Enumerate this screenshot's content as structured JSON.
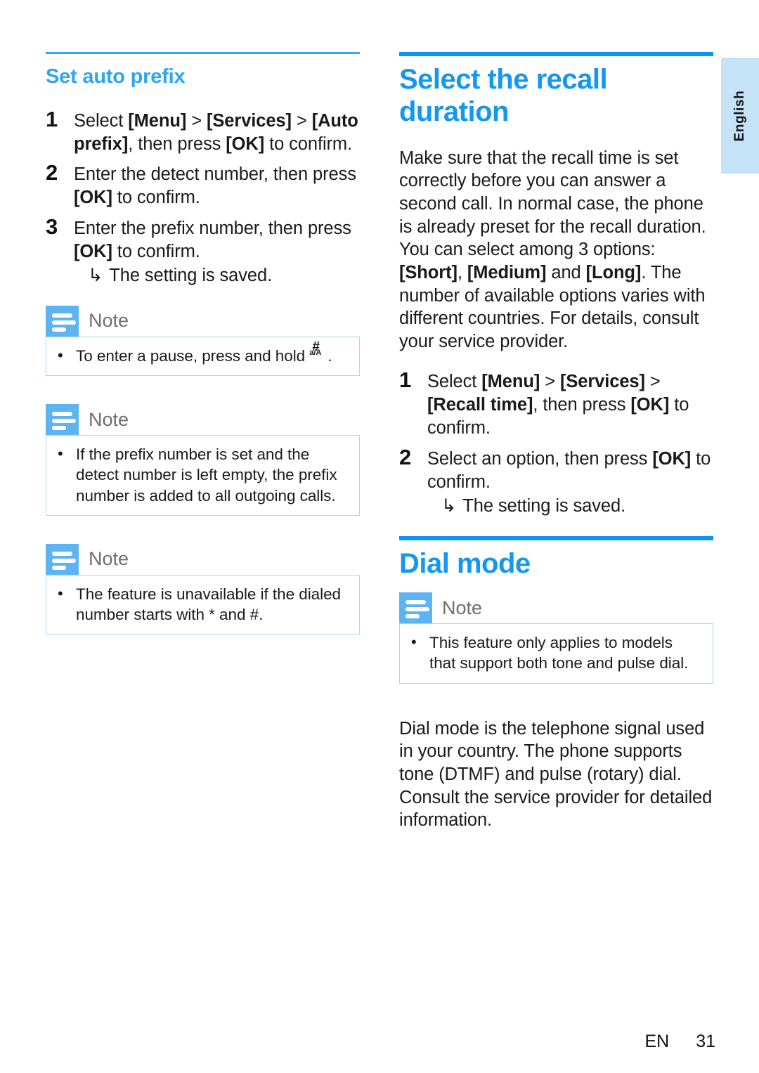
{
  "language_tab": {
    "label": "English"
  },
  "colors": {
    "heading_blue": "#1497f0",
    "subheading_blue": "#2fa5f2",
    "rule_blue": "#0d94f5",
    "note_icon_blue": "#5cb5f2",
    "note_border_blue": "#a6d7f3",
    "lang_tab_blue": "#c5e3f7"
  },
  "left_column": {
    "subheading": "Set auto prefix",
    "steps": [
      {
        "number": "1",
        "text_parts": [
          {
            "t": "Select ",
            "bold": false
          },
          {
            "t": "[Menu]",
            "bold": true
          },
          {
            "t": " > ",
            "bold": false
          },
          {
            "t": "[Services]",
            "bold": true
          },
          {
            "t": " > ",
            "bold": false
          },
          {
            "t": "[Auto prefix]",
            "bold": true
          },
          {
            "t": ", then press ",
            "bold": false
          },
          {
            "t": "[OK]",
            "bold": true
          },
          {
            "t": " to confirm.",
            "bold": false
          }
        ]
      },
      {
        "number": "2",
        "text_parts": [
          {
            "t": "Enter the detect number, then press ",
            "bold": false
          },
          {
            "t": "[OK]",
            "bold": true
          },
          {
            "t": " to confirm.",
            "bold": false
          }
        ]
      },
      {
        "number": "3",
        "text_parts": [
          {
            "t": "Enter the prefix number, then press ",
            "bold": false
          },
          {
            "t": "[OK]",
            "bold": true
          },
          {
            "t": " to confirm.",
            "bold": false
          }
        ],
        "result": "The setting is saved.",
        "result_arrow": "↳"
      }
    ],
    "notes": [
      {
        "title": "Note",
        "bullet": "•",
        "text_before": "To enter a pause, press and hold ",
        "key_glyph": {
          "main": "#",
          "sub": "a/A"
        },
        "text_after": "."
      },
      {
        "title": "Note",
        "bullet": "•",
        "text": "If the prefix number is set and the detect number is left empty, the prefix number is added to all outgoing calls."
      },
      {
        "title": "Note",
        "bullet": "•",
        "text": "The feature is unavailable if the dialed number starts with * and #."
      }
    ]
  },
  "right_column": {
    "section1": {
      "heading": "Select the recall duration",
      "paragraph_parts": [
        {
          "t": "Make sure that the recall time is set correctly before you can answer a second call. In normal case, the phone is already preset for the recall duration. You can select among 3 options: ",
          "bold": false
        },
        {
          "t": "[Short]",
          "bold": true
        },
        {
          "t": ", ",
          "bold": false
        },
        {
          "t": "[Medium]",
          "bold": true
        },
        {
          "t": " and ",
          "bold": false
        },
        {
          "t": "[Long]",
          "bold": true
        },
        {
          "t": ". The number of available options varies with different countries. For details, consult your service provider.",
          "bold": false
        }
      ],
      "steps": [
        {
          "number": "1",
          "text_parts": [
            {
              "t": "Select ",
              "bold": false
            },
            {
              "t": "[Menu]",
              "bold": true
            },
            {
              "t": " > ",
              "bold": false
            },
            {
              "t": "[Services]",
              "bold": true
            },
            {
              "t": " > ",
              "bold": false
            },
            {
              "t": "[Recall time]",
              "bold": true
            },
            {
              "t": ", then press ",
              "bold": false
            },
            {
              "t": "[OK]",
              "bold": true
            },
            {
              "t": " to confirm.",
              "bold": false
            }
          ]
        },
        {
          "number": "2",
          "text_parts": [
            {
              "t": "Select an option, then press ",
              "bold": false
            },
            {
              "t": "[OK]",
              "bold": true
            },
            {
              "t": " to confirm.",
              "bold": false
            }
          ],
          "result": "The setting is saved.",
          "result_arrow": "↳"
        }
      ]
    },
    "section2": {
      "heading": "Dial mode",
      "note": {
        "title": "Note",
        "bullet": "•",
        "text": "This feature only applies to models that support both tone and pulse dial."
      },
      "paragraph": "Dial mode is the telephone signal used in your country. The phone supports tone (DTMF) and pulse (rotary) dial. Consult the service provider for detailed information."
    }
  },
  "footer": {
    "language_code": "EN",
    "page_number": "31"
  }
}
